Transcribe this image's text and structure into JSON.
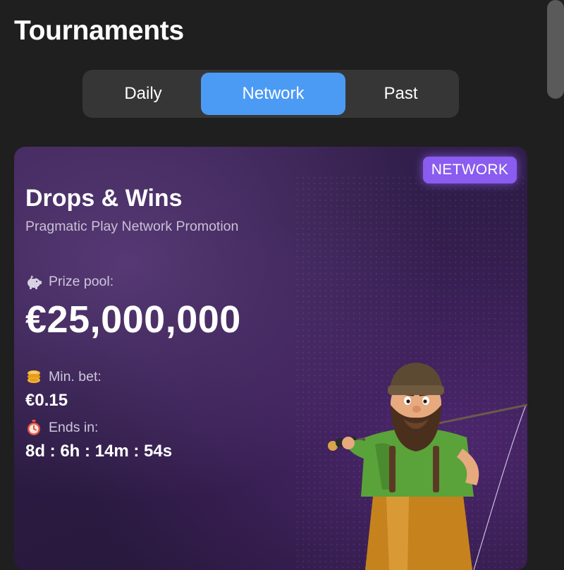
{
  "page": {
    "title": "Tournaments"
  },
  "tabs": [
    {
      "label": "Daily",
      "active": false
    },
    {
      "label": "Network",
      "active": true
    },
    {
      "label": "Past",
      "active": false
    }
  ],
  "card": {
    "badge": "NETWORK",
    "title": "Drops & Wins",
    "subtitle": "Pragmatic Play Network Promotion",
    "prize_label": "Prize pool:",
    "prize_value": "€25,000,000",
    "min_bet_label": "Min. bet:",
    "min_bet_value": "€0.15",
    "ends_label": "Ends in:",
    "ends_value": "8d : 6h : 14m : 54s",
    "icons": [
      "piggy-bank-icon",
      "coins-icon",
      "stopwatch-icon"
    ],
    "mascot": "fisherman-mascot"
  },
  "colors": {
    "background": "#1f1f1f",
    "tab_bar": "#363636",
    "tab_active": "#4b9bf5",
    "badge": "#8a5cf0",
    "card": "#2c1b44"
  }
}
